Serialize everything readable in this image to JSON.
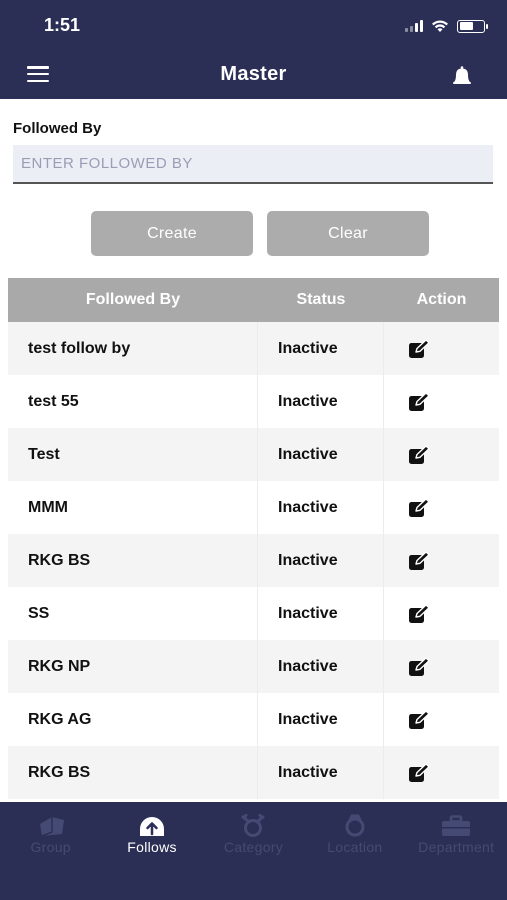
{
  "status_bar": {
    "time": "1:51"
  },
  "header": {
    "title": "Master"
  },
  "form": {
    "label": "Followed By",
    "placeholder": "ENTER FOLLOWED BY",
    "value": ""
  },
  "buttons": {
    "create": "Create",
    "clear": "Clear"
  },
  "table": {
    "columns": [
      "Followed By",
      "Status",
      "Action"
    ],
    "rows": [
      {
        "name": "test follow by",
        "status": "Inactive"
      },
      {
        "name": "test 55",
        "status": "Inactive"
      },
      {
        "name": "Test",
        "status": "Inactive"
      },
      {
        "name": "MMM",
        "status": "Inactive"
      },
      {
        "name": "RKG BS",
        "status": "Inactive"
      },
      {
        "name": "SS",
        "status": "Inactive"
      },
      {
        "name": "RKG NP",
        "status": "Inactive"
      },
      {
        "name": "RKG AG",
        "status": "Inactive"
      },
      {
        "name": "RKG BS",
        "status": "Inactive"
      }
    ]
  },
  "tabbar": {
    "tabs": [
      {
        "label": "Group",
        "icon": "group-icon",
        "active": false
      },
      {
        "label": "Follows",
        "icon": "follows-icon",
        "active": true
      },
      {
        "label": "Category",
        "icon": "category-icon",
        "active": false
      },
      {
        "label": "Location",
        "icon": "location-icon",
        "active": false
      },
      {
        "label": "Department",
        "icon": "department-icon",
        "active": false
      }
    ]
  },
  "colors": {
    "header_bg": "#2b2f55",
    "button_bg": "#acacad",
    "table_header_bg": "#a9a9a9",
    "tab_inactive": "#454a75",
    "tab_active": "#ffffff"
  }
}
